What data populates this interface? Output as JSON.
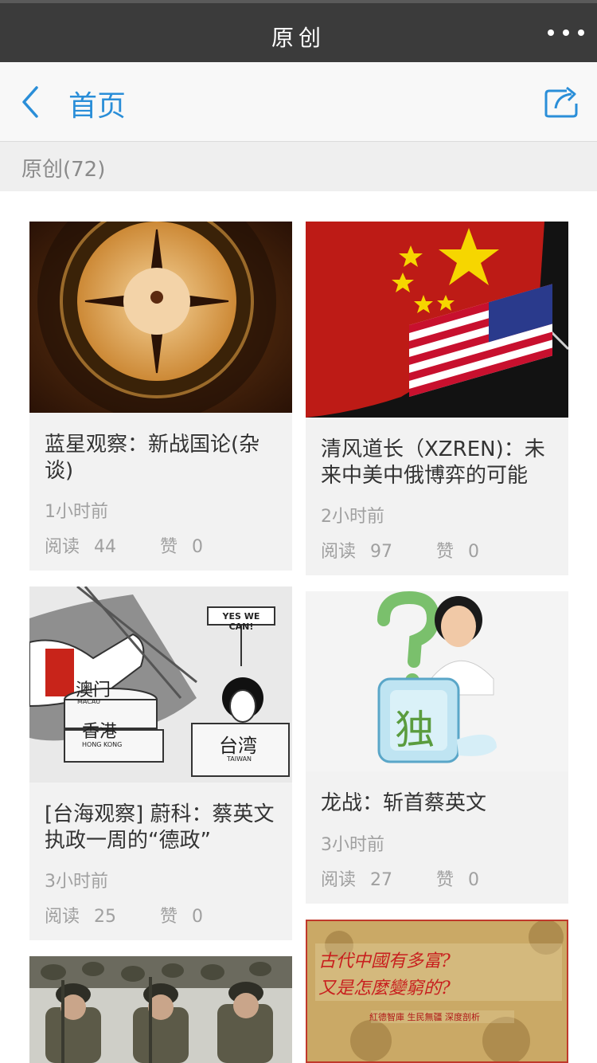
{
  "window": {
    "title": "原创"
  },
  "navbar": {
    "home_label": "首页"
  },
  "section": {
    "label": "原创(72)"
  },
  "stats_labels": {
    "read": "阅读",
    "like": "赞"
  },
  "cards": [
    {
      "title": "蓝星观察：新战国论(杂谈)",
      "time": "1小时前",
      "reads": "44",
      "likes": "0"
    },
    {
      "title": "清风道长（XZREN)：未来中美中俄博弈的可能",
      "time": "2小时前",
      "reads": "97",
      "likes": "0"
    },
    {
      "title": "[台海观察] 蔚科：蔡英文执政一周的“德政”",
      "time": "3小时前",
      "reads": "25",
      "likes": "0",
      "image_text": {
        "speech": "YES WE CAN!",
        "macau": "澳门",
        "macau_en": "MACAU",
        "hk": "香港",
        "hk_en": "HONG KONG",
        "tw": "台湾",
        "tw_en": "TAIWAN"
      }
    },
    {
      "title": "龙战：斩首蔡英文",
      "time": "3小时前",
      "reads": "27",
      "likes": "0",
      "image_text": {
        "cube": "独"
      }
    },
    {
      "title": "",
      "time": "",
      "reads": "",
      "likes": ""
    },
    {
      "title": "",
      "time": "",
      "reads": "",
      "likes": "",
      "image_text": {
        "line1": "古代中國有多富?",
        "line2": "又是怎麼變窮的?",
        "line3": "紅德智庫 生民無疆 深度剖析"
      }
    }
  ],
  "colors": {
    "accent": "#2a8ed8",
    "titlebar": "#3b3b3b",
    "card_bg": "#f2f2f2",
    "meta": "#a0a0a0"
  },
  "icons": {
    "back": "chevron-left-icon",
    "share": "share-icon",
    "more": "more-icon"
  }
}
